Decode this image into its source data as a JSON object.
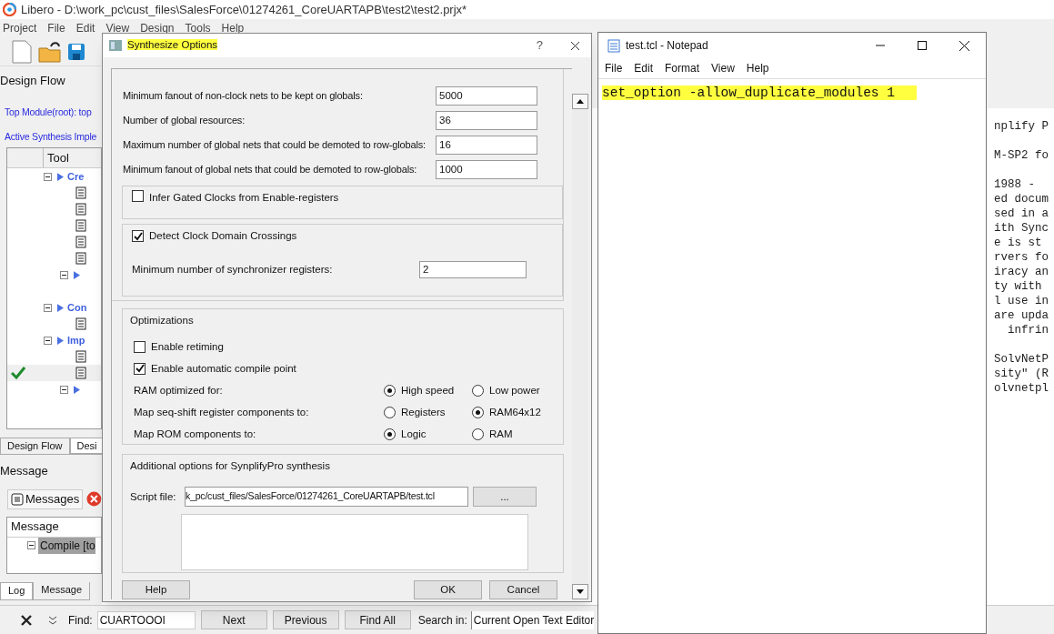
{
  "main_window": {
    "title": "Libero - D:\\work_pc\\cust_files\\SalesForce\\01274261_CoreUARTAPB\\test2\\test2.prjx*",
    "menu": [
      "Project",
      "File",
      "Edit",
      "View",
      "Design",
      "Tools",
      "Help"
    ],
    "design_flow": {
      "title": "Design Flow",
      "top_module": "Top Module(root): top",
      "active_synthesis": "Active Synthesis Imple",
      "column": "Tool",
      "tree": [
        {
          "kind": "group",
          "label": "Cre",
          "expanded": true,
          "children": [
            {
              "kind": "tool",
              "checked": false
            },
            {
              "kind": "tool",
              "checked": false
            },
            {
              "kind": "tool",
              "checked": false
            },
            {
              "kind": "tool",
              "checked": false
            },
            {
              "kind": "tool",
              "checked": false
            },
            {
              "kind": "group",
              "expanded": true,
              "children": [
                {
                  "kind": "leaf"
                }
              ]
            }
          ]
        },
        {
          "kind": "group",
          "label": "Con",
          "expanded": true,
          "children": [
            {
              "kind": "tool",
              "checked": false
            }
          ]
        },
        {
          "kind": "group",
          "label": "Imp",
          "expanded": true,
          "children": [
            {
              "kind": "tool",
              "checked": false
            },
            {
              "kind": "tool",
              "checked": true
            },
            {
              "kind": "group",
              "expanded": true,
              "children": [
                {
                  "kind": "leaf"
                },
                {
                  "kind": "leaf"
                },
                {
                  "kind": "leaf"
                }
              ]
            }
          ]
        }
      ]
    },
    "left_tabs": [
      {
        "label": "Design Flow",
        "selected": true
      },
      {
        "label": "Desi",
        "selected": false
      }
    ],
    "message_panel": {
      "title": "Message",
      "filter_button": "Messages",
      "column": "Message",
      "rows": [
        {
          "label": "Compile [to",
          "selected": true
        }
      ]
    },
    "bottom_tabs": [
      {
        "label": "Log",
        "selected": false
      },
      {
        "label": "Message",
        "selected": true
      }
    ],
    "log_paragraphs": [
      [
        "nplify P"
      ],
      [
        "M-SP2 fo"
      ],
      [
        "1988 -",
        "ed docum",
        "sed in a",
        "ith Sync",
        "e is st",
        "rvers fo",
        "iracy an",
        "ty with",
        "l use in",
        "are upda",
        "  infrin"
      ],
      [
        "SolvNetP",
        "sity\" (R",
        "olvnetpl"
      ]
    ],
    "find_bar": {
      "find_label": "Find:",
      "find_value": "CUARTOOOI",
      "buttons": [
        "Next",
        "Previous",
        "Find All"
      ],
      "search_in_label": "Search in:",
      "search_in_value": "Current Open Text Editor"
    }
  },
  "dialog": {
    "title": "Synthesize Options",
    "help_glyph": "?",
    "fields": [
      {
        "label": "Minimum fanout of non-clock nets to be kept on globals:",
        "value": "5000"
      },
      {
        "label": "Number of global resources:",
        "value": "36"
      },
      {
        "label": "Maximum number of global nets that could be demoted to row-globals:",
        "value": "16"
      },
      {
        "label": "Minimum fanout of global nets that could be demoted to row-globals:",
        "value": "1000"
      }
    ],
    "gated_clocks": {
      "label": "Infer Gated Clocks from Enable-registers",
      "checked": false
    },
    "clock_domain": {
      "label": "Detect Clock Domain Crossings",
      "checked": true,
      "field_label": "Minimum number of synchronizer registers:",
      "field_value": "2"
    },
    "optimizations": {
      "title": "Optimizations",
      "items": [
        {
          "kind": "checkbox",
          "label": "Enable retiming",
          "checked": false
        },
        {
          "kind": "checkbox",
          "label": "Enable automatic compile point",
          "checked": true
        },
        {
          "kind": "radio",
          "label": "RAM optimized for:",
          "options": [
            {
              "label": "High speed",
              "selected": true
            },
            {
              "label": "Low power",
              "selected": false
            }
          ]
        },
        {
          "kind": "radio",
          "label": "Map seq-shift register components to:",
          "options": [
            {
              "label": "Registers",
              "selected": false
            },
            {
              "label": "RAM64x12",
              "selected": true
            }
          ]
        },
        {
          "kind": "radio",
          "label": "Map ROM components to:",
          "options": [
            {
              "label": "Logic",
              "selected": true
            },
            {
              "label": "RAM",
              "selected": false
            }
          ]
        }
      ]
    },
    "additional": {
      "title": "Additional options for SynplifyPro synthesis",
      "script_label": "Script file:",
      "script_value": "k_pc/cust_files/SalesForce/01274261_CoreUARTAPB/test.tcl",
      "browse_button": "..."
    },
    "buttons": {
      "help": "Help",
      "ok": "OK",
      "cancel": "Cancel"
    }
  },
  "notepad": {
    "title": "test.tcl - Notepad",
    "menu": [
      "File",
      "Edit",
      "Format",
      "View",
      "Help"
    ],
    "text": "set_option -allow_duplicate_modules 1",
    "highlighted": true
  }
}
